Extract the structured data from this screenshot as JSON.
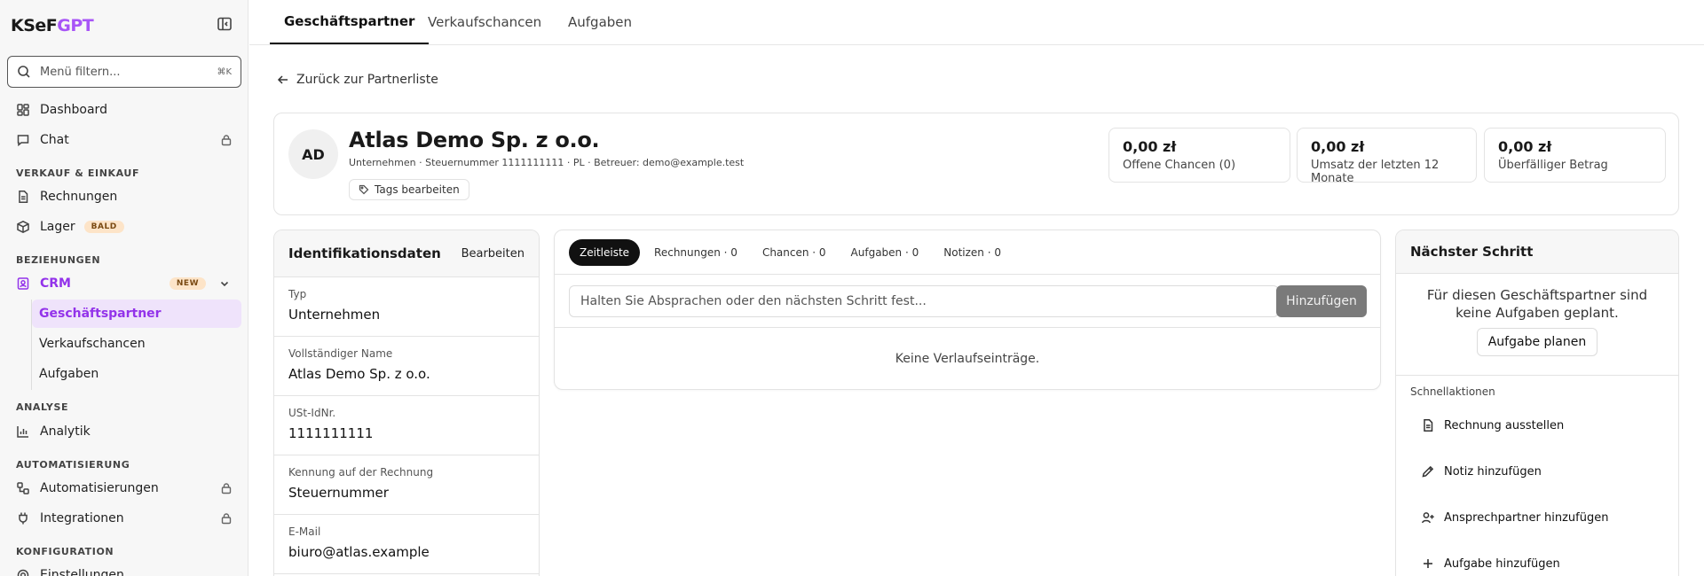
{
  "sidebar": {
    "brand_part1": "KSeF",
    "brand_part2": "GPT",
    "search_placeholder": "Menü filtern...",
    "search_shortcut": "⌘K",
    "dashboard": "Dashboard",
    "chat": "Chat",
    "section_sales": "VERKAUF & EINKAUF",
    "invoices": "Rechnungen",
    "warehouse": "Lager",
    "warehouse_badge": "BALD",
    "section_relations": "BEZIEHUNGEN",
    "crm": "CRM",
    "crm_badge": "NEW",
    "crm_items": [
      "Geschäftspartner",
      "Verkaufschancen",
      "Aufgaben"
    ],
    "section_analysis": "ANALYSE",
    "analytics": "Analytik",
    "section_automation": "AUTOMATISIERUNG",
    "automations": "Automatisierungen",
    "integrations": "Integrationen",
    "section_config": "KONFIGURATION",
    "settings": "Einstellungen"
  },
  "top_tabs": [
    "Geschäftspartner",
    "Verkaufschancen",
    "Aufgaben"
  ],
  "back_link": "Zurück zur Partnerliste",
  "partner": {
    "initials": "AD",
    "name": "Atlas Demo Sp. z o.o.",
    "meta": "Unternehmen · Steuernummer 1111111111 · PL · Betreuer: demo@example.test",
    "tags_button": "Tags bearbeiten"
  },
  "stats": [
    {
      "value": "0,00 zł",
      "label": "Offene Chancen (0)"
    },
    {
      "value": "0,00 zł",
      "label": "Umsatz der letzten 12 Monate"
    },
    {
      "value": "0,00 zł",
      "label": "Überfälliger Betrag"
    }
  ],
  "identification": {
    "title": "Identifikationsdaten",
    "edit": "Bearbeiten",
    "fields": [
      {
        "label": "Typ",
        "value": "Unternehmen"
      },
      {
        "label": "Vollständiger Name",
        "value": "Atlas Demo Sp. z o.o."
      },
      {
        "label": "USt-IdNr.",
        "value": "1111111111"
      },
      {
        "label": "Kennung auf der Rechnung",
        "value": "Steuernummer"
      },
      {
        "label": "E-Mail",
        "value": "biuro@atlas.example"
      }
    ]
  },
  "timeline": {
    "tabs": [
      "Zeitleiste",
      "Rechnungen · 0",
      "Chancen · 0",
      "Aufgaben · 0",
      "Notizen · 0"
    ],
    "input_placeholder": "Halten Sie Absprachen oder den nächsten Schritt fest...",
    "add_button": "Hinzufügen",
    "empty": "Keine Verlaufseinträge."
  },
  "next_step": {
    "title": "Nächster Schritt",
    "message": "Für diesen Geschäftspartner sind keine Aufgaben geplant.",
    "plan_button": "Aufgabe planen",
    "quick_title": "Schnellaktionen",
    "actions": [
      "Rechnung ausstellen",
      "Notiz hinzufügen",
      "Ansprechpartner hinzufügen",
      "Aufgabe hinzufügen"
    ]
  },
  "colors": {
    "accent": "#9333ea",
    "badge_bg": "#fde4c8",
    "button_disabled": "#7a7a7a"
  }
}
